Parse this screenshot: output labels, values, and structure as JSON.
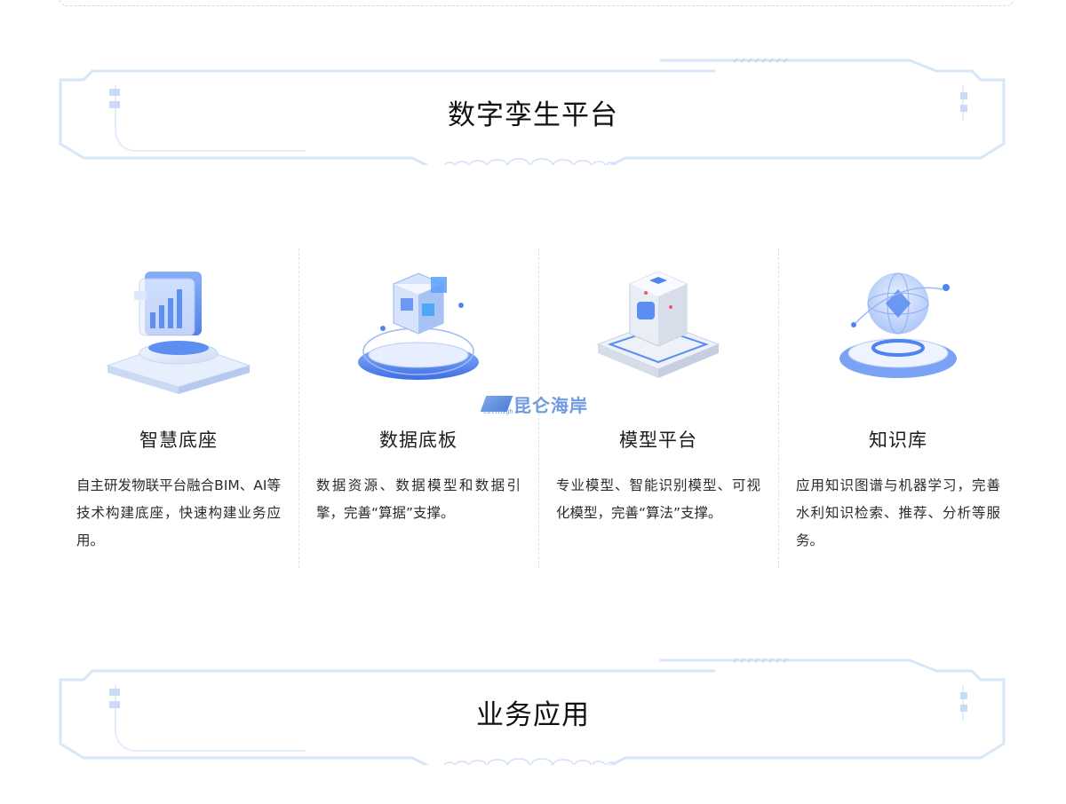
{
  "colors": {
    "frame_line": "#d7e6f8",
    "frame_accent": "#bcd4f3",
    "icon_blue": "#4f84f0",
    "watermark": "#6f9ae2"
  },
  "sections": [
    {
      "title": "数字孪生平台"
    },
    {
      "title": "业务应用"
    }
  ],
  "features": [
    {
      "icon": "bar-chart-pedestal-icon",
      "title": "智慧底座",
      "desc": "自主研发物联平台融合BIM、AI等技术构建底座，快速构建业务应用。"
    },
    {
      "icon": "data-cubes-pedestal-icon",
      "title": "数据底板",
      "desc": "数据资源、数据模型和数据引擎，完善“算据”支撑。"
    },
    {
      "icon": "model-cube-platform-icon",
      "title": "模型平台",
      "desc": "专业模型、智能识别模型、可视化模型，完善“算法”支撑。"
    },
    {
      "icon": "knowledge-globe-pedestal-icon",
      "title": "知识库",
      "desc": "应用知识图谱与机器学习，完善水利知识检索、推荐、分析等服务。"
    }
  ],
  "watermark": {
    "text": "昆仑海岸",
    "sub": "CollHigh"
  }
}
